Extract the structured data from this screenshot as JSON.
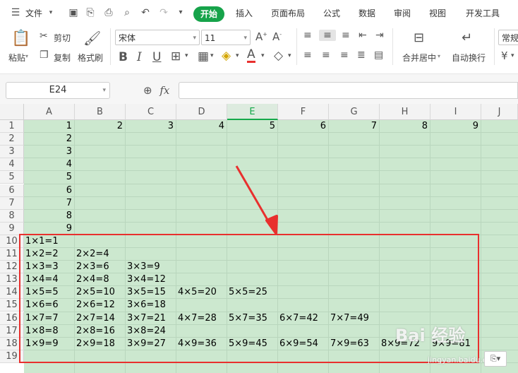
{
  "menu": {
    "file": "文件",
    "tabs": [
      "开始",
      "插入",
      "页面布局",
      "公式",
      "数据",
      "审阅",
      "视图",
      "开发工具"
    ]
  },
  "toolbar": {
    "paste": "粘贴",
    "cut": "剪切",
    "copy": "复制",
    "format_painter": "格式刷",
    "font_name": "宋体",
    "font_size": "11",
    "merge_center": "合并居中",
    "wrap_text": "自动换行",
    "number_format": "常规"
  },
  "formula_bar": {
    "name_box": "E24",
    "fx_label": "fx",
    "value": ""
  },
  "columns": [
    "A",
    "B",
    "C",
    "D",
    "E",
    "F",
    "G",
    "H",
    "I",
    "J"
  ],
  "selected_column": "E",
  "rows": [
    "1",
    "2",
    "3",
    "4",
    "5",
    "6",
    "7",
    "8",
    "9",
    "10",
    "11",
    "12",
    "13",
    "14",
    "15",
    "16",
    "17",
    "18",
    "19"
  ],
  "row1_values": [
    "1",
    "2",
    "3",
    "4",
    "5",
    "6",
    "7",
    "8",
    "9"
  ],
  "colA_values": [
    "2",
    "3",
    "4",
    "5",
    "6",
    "7",
    "8",
    "9"
  ],
  "table_rows": [
    [
      "1×1=1"
    ],
    [
      "1×2=2",
      "2×2=4"
    ],
    [
      "1×3=3",
      "2×3=6",
      "3×3=9"
    ],
    [
      "1×4=4",
      "2×4=8",
      "3×4=12"
    ],
    [
      "1×5=5",
      "2×5=10",
      "3×5=15",
      "4×5=20",
      "5×5=25"
    ],
    [
      "1×6=6",
      "2×6=12",
      "3×6=18"
    ],
    [
      "1×7=7",
      "2×7=14",
      "3×7=21",
      "4×7=28",
      "5×7=35",
      "6×7=42",
      "7×7=49"
    ],
    [
      "1×8=8",
      "2×8=16",
      "3×8=24"
    ],
    [
      "1×9=9",
      "2×9=18",
      "3×9=27",
      "4×9=36",
      "5×9=45",
      "6×9=54",
      "7×9=63",
      "8×9=72",
      "9×9=81"
    ]
  ],
  "watermark": {
    "brand": "Bai 经验",
    "url": "jingyan.baidu.com"
  },
  "colors": {
    "accent": "#16a34a",
    "sheet_bg": "#cce8cf",
    "highlight": "#e8302e"
  }
}
